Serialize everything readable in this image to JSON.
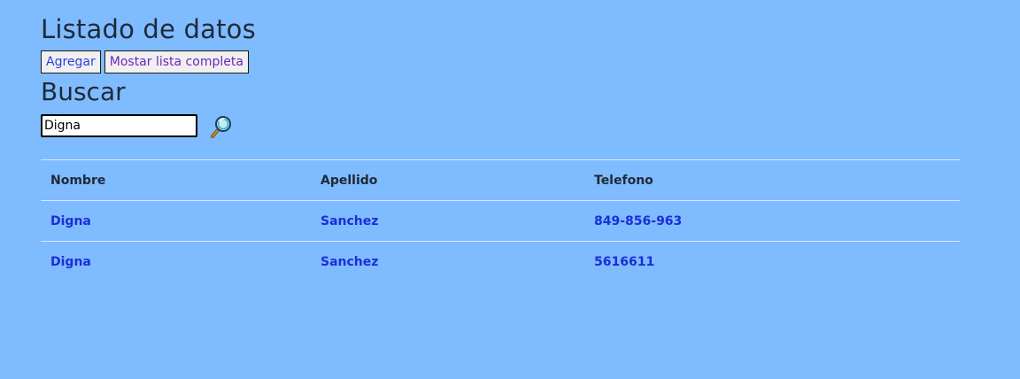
{
  "page": {
    "title": "Listado de datos"
  },
  "toolbar": {
    "add_label": "Agregar",
    "full_list_label": "Mostar lista completa"
  },
  "search": {
    "title": "Buscar",
    "value": "Digna",
    "icon": "magnifier-icon"
  },
  "table": {
    "headers": [
      "Nombre",
      "Apellido",
      "Telefono"
    ],
    "rows": [
      [
        "Digna",
        "Sanchez",
        "849-856-963"
      ],
      [
        "Digna",
        "Sanchez",
        "5616611"
      ]
    ]
  },
  "colors": {
    "background": "#7fbbff",
    "heading_text": "#1f2a38",
    "link_text": "#1b2fd6",
    "row_divider": "#d8e8fb"
  }
}
